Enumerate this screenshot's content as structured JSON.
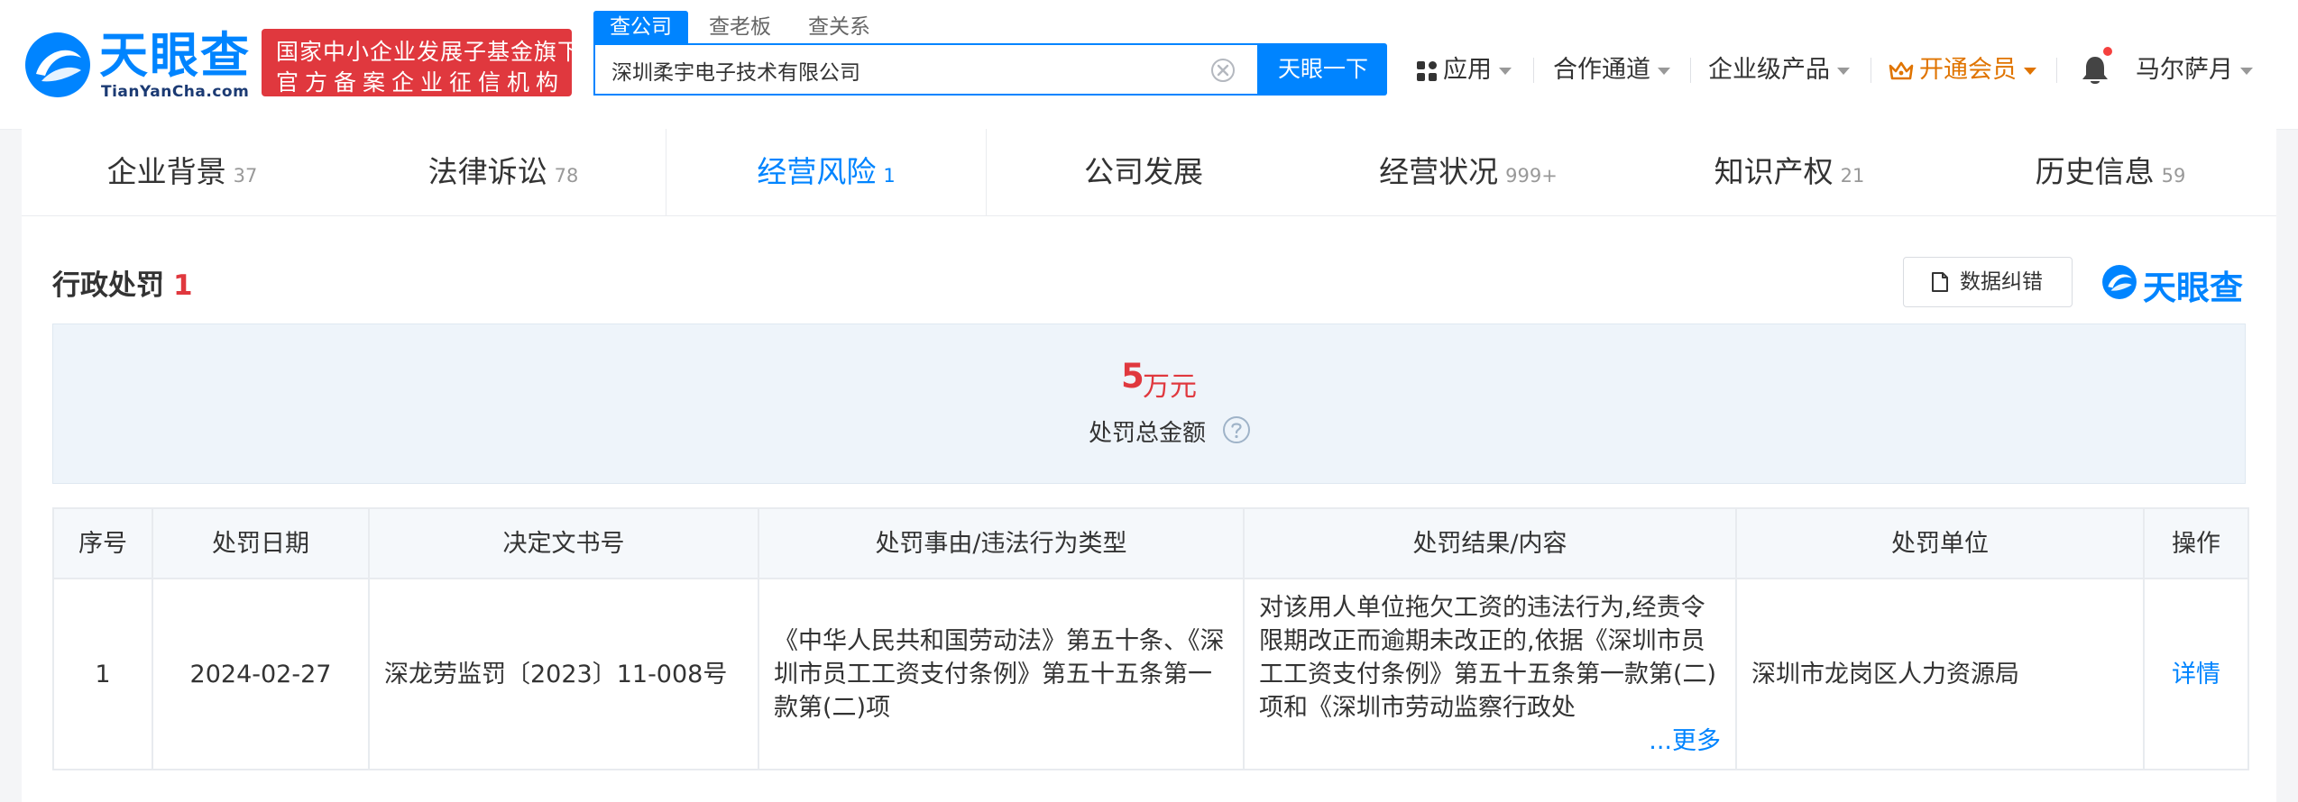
{
  "brand": {
    "name": "天眼查",
    "domain": "TianYanCha.com",
    "gov_line1": "国家中小企业发展子基金旗下",
    "gov_line2": "官方备案企业征信机构",
    "color": "#0084ff"
  },
  "search": {
    "tabs": [
      "查公司",
      "查老板",
      "查关系"
    ],
    "active_tab": "查公司",
    "value": "深圳柔宇电子技术有限公司",
    "button": "天眼一下"
  },
  "nav": {
    "apps": "应用",
    "cooperation": "合作通道",
    "enterprise": "企业级产品",
    "vip": "开通会员",
    "user": "马尔萨月"
  },
  "tabs": [
    {
      "label": "企业背景",
      "count": "37"
    },
    {
      "label": "法律诉讼",
      "count": "78"
    },
    {
      "label": "经营风险",
      "count": "1"
    },
    {
      "label": "公司发展",
      "count": ""
    },
    {
      "label": "经营状况",
      "count": "999+"
    },
    {
      "label": "知识产权",
      "count": "21"
    },
    {
      "label": "历史信息",
      "count": "59"
    }
  ],
  "section": {
    "title": "行政处罚",
    "count": "1",
    "correct_button": "数据纠错",
    "brand_mark": "天眼查"
  },
  "summary": {
    "amount": "5",
    "unit": "万元",
    "label": "处罚总金额"
  },
  "table": {
    "headers": [
      "序号",
      "处罚日期",
      "决定文书号",
      "处罚事由/违法行为类型",
      "处罚结果/内容",
      "处罚单位",
      "操作"
    ],
    "rows": [
      {
        "index": "1",
        "date": "2024-02-27",
        "doc_no": "深龙劳监罚〔2023〕11-008号",
        "reason": "《中华人民共和国劳动法》第五十条、《深圳市员工工资支付条例》第五十五条第一款第(二)项",
        "result": "对该用人单位拖欠工资的违法行为,经责令限期改正而逾期未改正的,依据《深圳市员工工资支付条例》第五十五条第一款第(二)项和《深圳市劳动监察行政处",
        "more": "...更多",
        "authority": "深圳市龙岗区人力资源局",
        "action": "详情"
      }
    ]
  },
  "colors": {
    "accent": "#0084ff",
    "danger": "#e0383e",
    "vip": "#e07400",
    "summary_bg": "#eef4fa",
    "header_bg": "#f5f8fb"
  }
}
